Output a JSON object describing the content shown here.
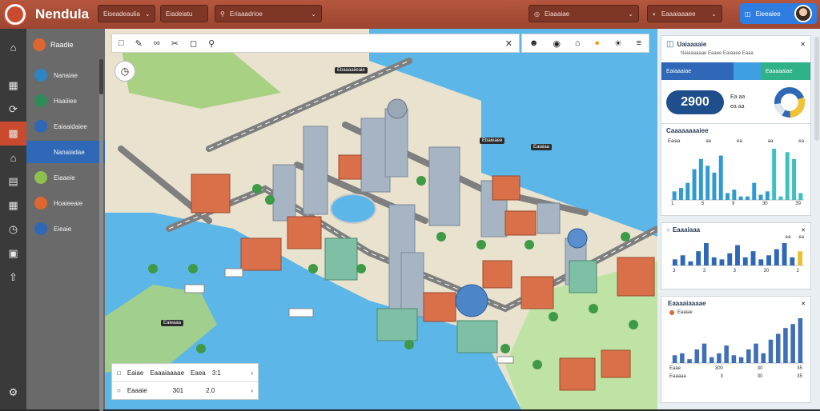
{
  "app": {
    "title": "Nendula"
  },
  "topbar": {
    "dropdown1": "Eiseadeaulia",
    "dropdown2": "Eiadeiatu",
    "search": "Eriaaadrioe",
    "dropdown3": "Eiaaaiae",
    "dropdown4": "Eaaaiaaaee",
    "button": "Eieeaiee"
  },
  "sidebar": {
    "header": "Raadie",
    "items": [
      {
        "label": "Nanaiae",
        "color": "#2e86c1"
      },
      {
        "label": "Haaiiiee",
        "color": "#2e8b57"
      },
      {
        "label": "Eaiaaidaiee",
        "color": "#2f68b7"
      },
      {
        "label": "Nanaiadae",
        "color": "#2f68b7",
        "active": true
      },
      {
        "label": "Eiaaeie",
        "color": "#8fbf4f"
      },
      {
        "label": "Hoaieeaie",
        "color": "#e0662f"
      },
      {
        "label": "Eieaie",
        "color": "#2f68b7"
      }
    ]
  },
  "map": {
    "labels": [
      "Ebaaaaiieaie",
      "Ebaieaee",
      "Eaiaiaa",
      "Eaieaaa"
    ],
    "info": {
      "row1": {
        "a": "Eaiae",
        "b": "Eaaaiaaaae",
        "c": "Eaea",
        "d": "3:1"
      },
      "row2": {
        "a": "Eaaaie",
        "b": "301",
        "c": "2.0"
      }
    }
  },
  "panel": {
    "card1": {
      "title": "Uaiaaaaie",
      "subtitle": "Naiaaaaaae Eaaee Eaiaaee Eaaa",
      "tab1": "Eaiaaaiae",
      "tab2": "Eaaaaaiae",
      "kpi": "2900",
      "kpi_sub": "Ea aa",
      "kpi_sub2": "ea aa"
    },
    "card2": {
      "title": "Caaaaaaaaiee",
      "legend": [
        "Eaiaa",
        "aa",
        "ea",
        "aa",
        "ea"
      ],
      "bars": [
        10,
        14,
        20,
        36,
        48,
        40,
        32,
        52,
        8,
        12,
        4,
        4,
        20,
        6,
        10,
        60,
        4,
        56,
        48,
        8
      ],
      "xticks": [
        "1",
        "5",
        "9",
        "30",
        "39"
      ],
      "colors": {
        "c1": "#2f9bd0",
        "c2": "#3fc0c0"
      }
    },
    "card3": {
      "title": "Eaaaiaaa",
      "legend": [
        "ea",
        "ea"
      ],
      "bars": [
        6,
        10,
        4,
        14,
        22,
        8,
        6,
        12,
        20,
        8,
        14,
        6,
        10,
        16,
        22,
        8,
        14
      ],
      "xticks": [
        "3",
        "3",
        "3",
        "30",
        "2"
      ]
    },
    "card4": {
      "title": "Eaaaaiaaaae",
      "legend": [
        "Eaaiae"
      ],
      "bars": [
        8,
        10,
        4,
        14,
        20,
        6,
        10,
        18,
        8,
        6,
        14,
        20,
        10,
        24,
        30,
        36,
        40,
        46
      ],
      "rows": [
        {
          "a": "Eaae",
          "b": "300",
          "c": "30",
          "d": "35"
        },
        {
          "a": "Eaaaaa",
          "b": "3",
          "c": "30",
          "d": "35"
        }
      ]
    }
  }
}
